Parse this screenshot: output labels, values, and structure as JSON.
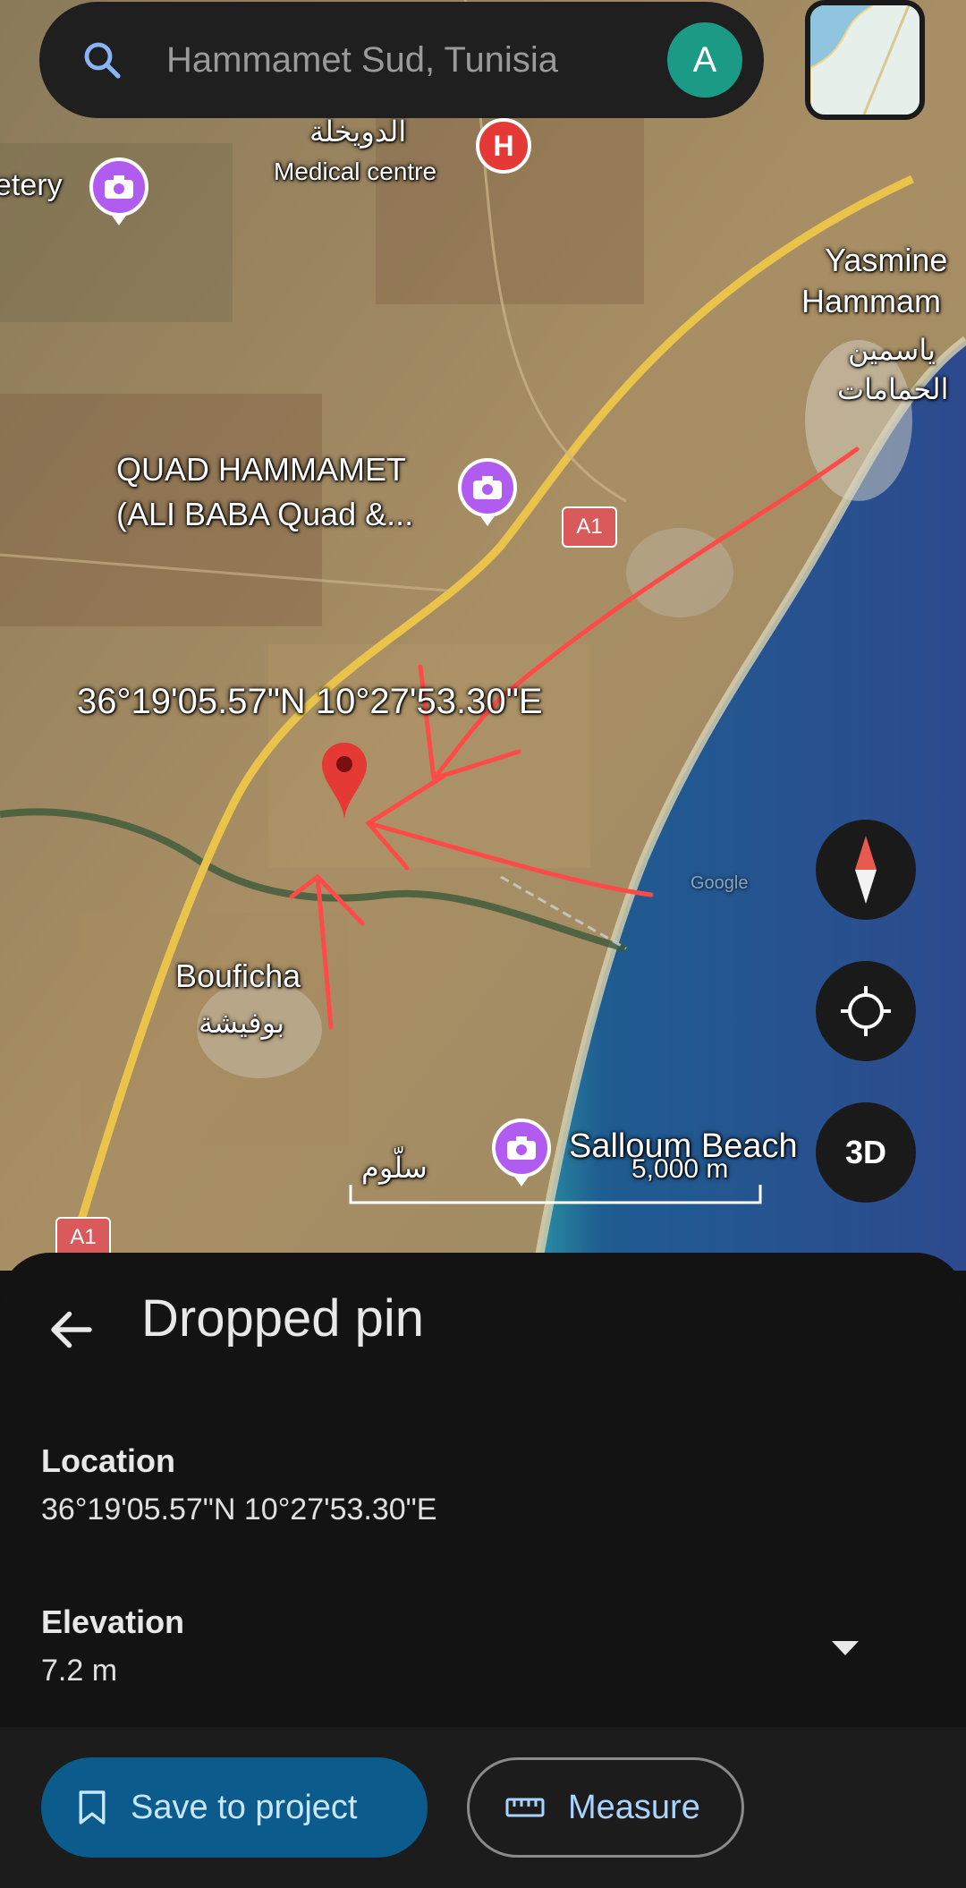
{
  "search": {
    "placeholder": "Hammamet Sud, Tunisia",
    "avatar_letter": "A"
  },
  "map": {
    "places": {
      "medical_ar": "الدويخلة",
      "medical": "Medical centre",
      "cemetery": "etery",
      "yasmine_1": "Yasmine",
      "yasmine_2": "Hammam",
      "yasmine_ar1": "ياسمين",
      "yasmine_ar2": "الحمامات",
      "quad_1": "QUAD HAMMAMET",
      "quad_2": "(ALI BABA Quad &...",
      "boufich": "Boufi",
      "boufich2": "cha",
      "bouficha_ar": "بوفيشة",
      "salloum_ar": "سلّوم",
      "salloum": "Salloum Beach",
      "google": "Google"
    },
    "road_badge": "A1",
    "coordinates_overlay": "36°19'05.57\"N 10°27'53.30\"E",
    "scale_label": "5,000 m",
    "btn_3d": "3D"
  },
  "sheet": {
    "title": "Dropped pin",
    "location_label": "Location",
    "location_value": "36°19'05.57\"N 10°27'53.30\"E",
    "elevation_label": "Elevation",
    "elevation_value": "7.2 m"
  },
  "actions": {
    "save": "Save to project",
    "measure": "Measure"
  },
  "colors": {
    "accent_blue": "#0b5b8c",
    "pin_red": "#e53935",
    "annotation_red": "#ff4a4a",
    "poi_purple": "#b15cf0"
  }
}
